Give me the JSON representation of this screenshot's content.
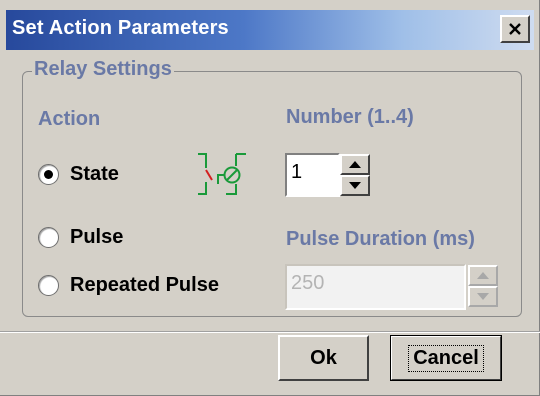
{
  "window": {
    "title": "Set Action Parameters"
  },
  "group": {
    "title": "Relay Settings"
  },
  "action": {
    "heading": "Action",
    "options": [
      {
        "label": "State",
        "selected": true
      },
      {
        "label": "Pulse",
        "selected": false
      },
      {
        "label": "Repeated Pulse",
        "selected": false
      }
    ]
  },
  "number": {
    "heading": "Number (1..4)",
    "value": "1"
  },
  "pulse_duration": {
    "heading": "Pulse Duration (ms)",
    "value": "250",
    "enabled": false
  },
  "buttons": {
    "ok": "Ok",
    "cancel": "Cancel"
  },
  "icons": {
    "close": "close-icon",
    "relay": "relay-icon",
    "spin_up": "spin-up-icon",
    "spin_down": "spin-down-icon"
  },
  "colors": {
    "titlebar_start": "#27499c",
    "label_blue": "#6a79a6",
    "relay_green": "#1a9a3a",
    "relay_red": "#d32020"
  }
}
